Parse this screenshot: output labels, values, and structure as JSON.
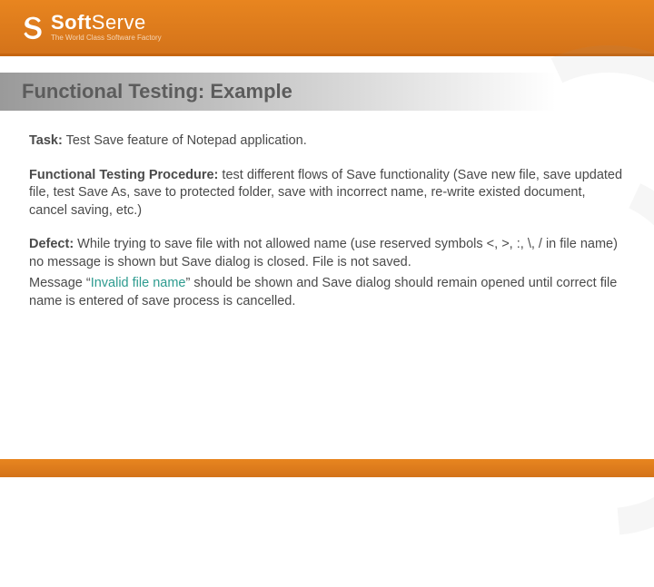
{
  "header": {
    "brand_prefix": "Soft",
    "brand_suffix": "Serve",
    "tagline": "The World Class Software Factory"
  },
  "title": "Functional Testing: Example",
  "body": {
    "task_label": "Task:",
    "task_text": " Test Save feature of Notepad application.",
    "proc_label": "Functional Testing Procedure:",
    "proc_text": " test different flows of Save functionality (Save new file, save updated file, test Save As, save to protected folder, save with incorrect name, re-write existed document, cancel saving, etc.)",
    "defect_label": "Defect:",
    "defect_text": " While trying to save file with not allowed name (use reserved symbols <, >, :, \\, / in file name) no message is shown but Save dialog is closed. File is not saved.",
    "msg_pre": "Message “",
    "msg_highlight": "Invalid file name",
    "msg_post": "” should be shown and Save dialog should remain opened until correct file name is entered of save process is cancelled."
  }
}
